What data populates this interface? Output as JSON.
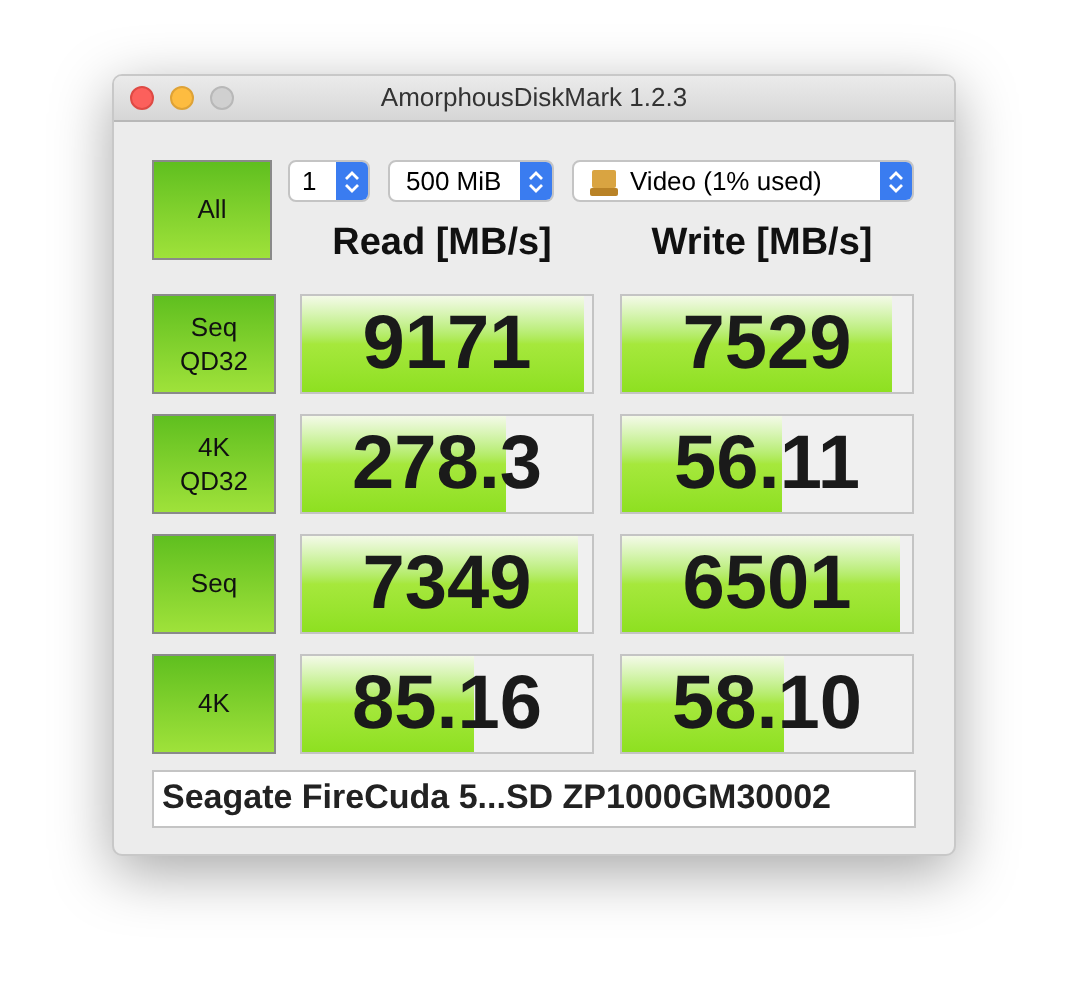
{
  "window": {
    "title": "AmorphousDiskMark 1.2.3"
  },
  "all_button": {
    "label": "All"
  },
  "settings": {
    "count": "1",
    "size": "500 MiB",
    "volume": "Video (1% used)"
  },
  "columns": [
    "Read [MB/s]",
    "Write [MB/s]"
  ],
  "rows": [
    {
      "test": "Seq\nQD32",
      "read": {
        "value": "9171",
        "level": 0.97
      },
      "write": {
        "value": "7529",
        "level": 0.93
      }
    },
    {
      "test": "4K\nQD32",
      "read": {
        "value": "278.3",
        "level": 0.7
      },
      "write": {
        "value": "56.11",
        "level": 0.55
      }
    },
    {
      "test": "Seq",
      "read": {
        "value": "7349",
        "level": 0.95
      },
      "write": {
        "value": "6501",
        "level": 0.96
      }
    },
    {
      "test": "4K",
      "read": {
        "value": "85.16",
        "level": 0.59
      },
      "write": {
        "value": "58.10",
        "level": 0.56
      }
    }
  ],
  "device": "Seagate FireCuda 5...SD ZP1000GM30002"
}
